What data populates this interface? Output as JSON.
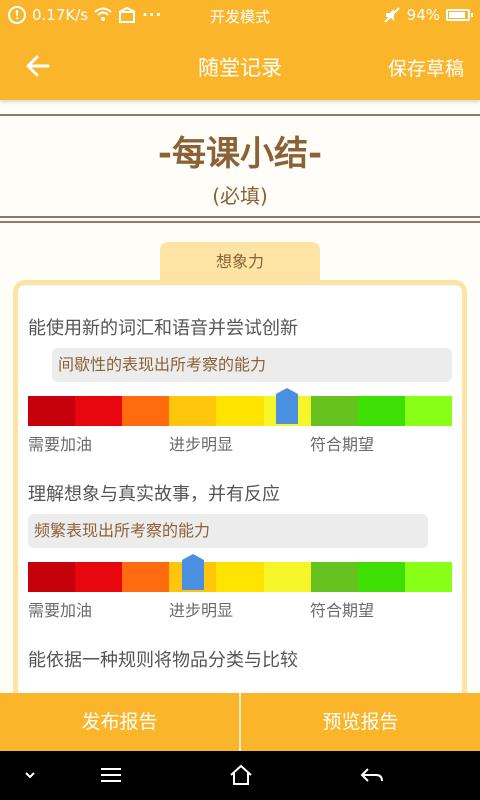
{
  "status_bar": {
    "network_speed": "0.17K/s",
    "mode": "开发模式",
    "battery": "94%",
    "battery_level": 0.94
  },
  "header": {
    "title": "随堂记录",
    "save_draft": "保存草稿",
    "back_icon": "back-arrow-icon"
  },
  "summary": {
    "title": "-每课小结-",
    "required": "(必填)"
  },
  "tab": {
    "label": "想象力"
  },
  "scale_labels": [
    "需要加油",
    "进步明显",
    "符合期望"
  ],
  "scale_colors": [
    "#c6000b",
    "#e8070f",
    "#ff6b0e",
    "#ffc60d",
    "#ffe400",
    "#f5f52a",
    "#66c21e",
    "#3ddf05",
    "#88ff16"
  ],
  "items": [
    {
      "question": "能使用新的词汇和语音并尝试创新",
      "answer": "间歇性的表现出所考察的能力",
      "level": 6
    },
    {
      "question": "理解想象与真实故事，并有反应",
      "answer": "频繁表现出所考察的能力",
      "level": 4
    },
    {
      "question": "能依据一种规则将物品分类与比较"
    }
  ],
  "footer": {
    "publish": "发布报告",
    "preview": "预览报告"
  },
  "nav": [
    "chevron-down-icon",
    "menu-icon",
    "home-icon",
    "back-icon"
  ]
}
